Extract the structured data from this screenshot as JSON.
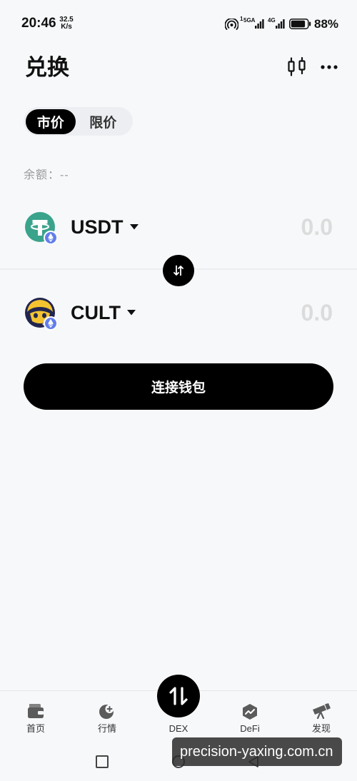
{
  "status_bar": {
    "time": "20:46",
    "net_speed_value": "32.5",
    "net_speed_unit": "K/s",
    "sim1_index": "1",
    "sim1_network": "5GA",
    "sim2_network": "4G",
    "battery_percent": "88%",
    "battery_level": 0.88,
    "icons": [
      "hotspot-icon",
      "signal-bars-icon",
      "signal-bars-icon",
      "battery-icon"
    ]
  },
  "header": {
    "title": "兑换",
    "right_icons": [
      "candlestick-chart-icon",
      "more-icon"
    ]
  },
  "order_type_tabs": {
    "items": [
      "市价",
      "限价"
    ],
    "active_index": 0
  },
  "balance": {
    "label": "余额：",
    "value": "--"
  },
  "swap_pair": {
    "from": {
      "symbol": "USDT",
      "logo": "usdt-logo",
      "chain_badge": "ethereum-icon",
      "amount_placeholder": "0.0"
    },
    "to": {
      "symbol": "CULT",
      "logo": "cult-logo",
      "chain_badge": "ethereum-icon",
      "amount_placeholder": "0.0"
    },
    "switch_icon": "swap-direction-icon"
  },
  "connect_wallet_button": {
    "label": "连接钱包"
  },
  "bottom_nav": {
    "items": [
      {
        "label": "首页",
        "icon": "wallet-icon"
      },
      {
        "label": "行情",
        "icon": "market-icon"
      },
      {
        "label": "DEX",
        "icon": "swap-arrows-icon"
      },
      {
        "label": "DeFi",
        "icon": "defi-icon"
      },
      {
        "label": "发现",
        "icon": "telescope-icon"
      }
    ],
    "active_index": 2
  },
  "system_nav": {
    "icons": [
      "recent-apps-icon",
      "home-icon",
      "back-icon"
    ]
  },
  "watermark": {
    "text": "precision-yaxing.com.cn"
  },
  "colors": {
    "background": "#f6f8fa",
    "primary": "#000000",
    "on_primary": "#ffffff",
    "text_primary": "#111111",
    "text_secondary": "#9a9a9a",
    "amount_placeholder": "#dcdcdc",
    "tab_track": "#eceef1",
    "usdt_green": "#3aa38b",
    "eth_blue": "#627eea",
    "nav_icon": "#5b5b5b"
  }
}
